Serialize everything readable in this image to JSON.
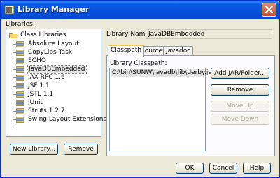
{
  "window": {
    "title": "Library Manager",
    "title_icon": "library-manager-icon",
    "close_icon": "close-icon"
  },
  "libraries_label": "Libraries:",
  "tree": {
    "root": "Class Libraries",
    "items": [
      "Absolute Layout",
      "CopyLibs Task",
      "ECHO",
      "JavaDBEmbedded",
      "JAX-RPC 1.6",
      "JSF 1.1",
      "JSTL 1.1",
      "JUnit",
      "Struts 1.2.7",
      "Swing Layout Extensions"
    ],
    "selected": "JavaDBEmbedded"
  },
  "library_name": {
    "label": "Library Name:",
    "value": "JavaDBEmbedded"
  },
  "tabs": [
    "Classpath",
    "Sources",
    "Javadoc"
  ],
  "active_tab": "Classpath",
  "classpath": {
    "label": "Library Classpath:",
    "items": [
      "C:\\bin\\SUNW\\javadb\\lib\\derby.jar"
    ]
  },
  "side_buttons": {
    "add": "Add JAR/Folder...",
    "remove": "Remove",
    "move_up": "Move Up",
    "move_down": "Move Down"
  },
  "bottom_buttons": {
    "new_library": "New Library...",
    "remove": "Remove",
    "ok": "OK",
    "cancel": "Cancel",
    "help": "Help"
  },
  "colors": {
    "titlebar": "#0551dc",
    "dialog_bg": "#ece9d8",
    "tab_highlight": "#ffc83c"
  }
}
